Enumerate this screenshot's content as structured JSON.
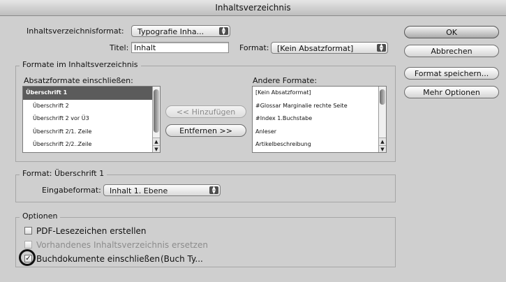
{
  "window": {
    "title": "Inhaltsverzeichnis"
  },
  "top": {
    "format_label": "Inhaltsverzeichnisformat:",
    "format_value": "Typografie Inha...",
    "title_label": "Titel:",
    "title_value": "Inhalt",
    "title_format_label": "Format:",
    "title_format_value": "[Kein Absatzformat]"
  },
  "buttons": {
    "ok": "OK",
    "cancel": "Abbrechen",
    "save_format": "Format speichern...",
    "more_options": "Mehr Optionen"
  },
  "formats_group": {
    "legend": "Formate im Inhaltsverzeichnis",
    "include_label": "Absatzformate einschließen:",
    "include_items": [
      "Überschrift 1",
      "Überschrift 2",
      "Überschrift 2 vor Ü3",
      "Überschrift 2/1. Zeile",
      "Überschrift 2/2..Zeile"
    ],
    "add_button": "<< Hinzufügen",
    "remove_button": "Entfernen >>",
    "other_label": "Andere Formate:",
    "other_items": [
      "[Kein Absatzformat]",
      "#Glossar Marginalie rechte Seite",
      "#Index 1.Buchstabe",
      "Anleser",
      "Artikelbeschreibung"
    ]
  },
  "style_group": {
    "legend": "Format: Überschrift 1",
    "entry_label": "Eingabeformat:",
    "entry_value": "Inhalt 1. Ebene"
  },
  "options_group": {
    "legend": "Optionen",
    "pdf_bookmarks": "PDF-Lesezeichen erstellen",
    "replace_existing": "Vorhandenes Inhaltsverzeichnis ersetzen",
    "include_book": "Buchdokumente einschließen",
    "book_name": "(Buch Ty..."
  },
  "colors": {
    "dialog_bg": "#cfcfcf",
    "selection": "#5b5b5b"
  }
}
